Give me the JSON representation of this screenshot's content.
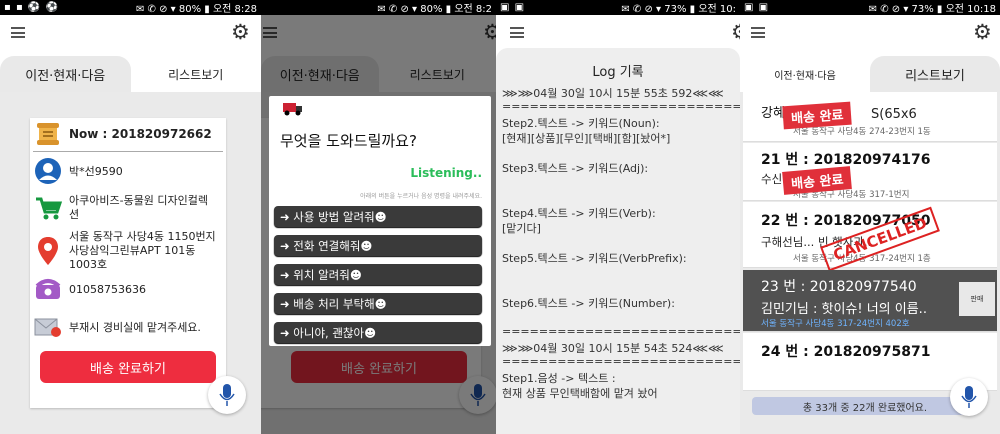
{
  "status_bars": [
    {
      "left": "▪ ▪ ⚽ ⚽",
      "right": "✉ ✆ ⊘ ▾ 80% ▮ 오전 8:28"
    },
    {
      "left": "",
      "right": "✉ ✆ ⊘ ▾ 80% ▮ 오전 8:2"
    },
    {
      "left": "▣ ▣",
      "right": "✉ ✆ ⊘ ▾ 73% ▮ 오전 10:"
    },
    {
      "left": "▣ ▣",
      "right": "✉ ✆ ⊘ ▾ 73% ▮ 오전 10:18"
    }
  ],
  "tabs": {
    "current": "이전·현재·다음",
    "list": "리스트보기"
  },
  "delivery": {
    "now": "Now : 201820972662",
    "name": "박*선9590",
    "shop": "아쿠아비즈-동물원 디자인컬렉션",
    "address": "서울 동작구  사당4동 1150번지 사당삼익그린뷰APT 101동 1003호",
    "phone": "01058753636",
    "memo": "부재시 경비실에 맡겨주세요.",
    "button": "배송 완료하기"
  },
  "assistant": {
    "question": "무엇을 도와드릴까요?",
    "listening": "Listening..",
    "hint": "아래의 버튼을 누르거나 음성 명령을 내려주세요.",
    "options": [
      "➜ 사용 방법 알려줘☻",
      "➜ 전화 연결해줘☻",
      "➜ 위치 알려줘☻",
      "➜ 배송 처리 부탁해☻",
      "➜ 아니야, 괜찮아☻"
    ]
  },
  "log": {
    "title": "Log 기록",
    "lines": [
      "⋙⋙04월 30일 10시 15분 55초 592⋘⋘",
      "================================",
      "Step2.텍스트 -> 키워드(Noun):",
      "[현재][상품][무인][택배][함][놨어*]",
      "",
      " Step3.텍스트 -> 키워드(Adj):",
      "",
      "",
      " Step4.텍스트 -> 키워드(Verb):",
      "[맡기다]",
      "",
      " Step5.텍스트 -> 키워드(VerbPrefix):",
      "",
      "",
      " Step6.텍스트 -> 키워드(Number):",
      "",
      "================================",
      "⋙⋙04월 30일 10시 15분 54초 524⋘⋘",
      "================================",
      "Step1.음성 -> 텍스트 :",
      "현재 상품 무인택배함에 맡겨 놨어"
    ]
  },
  "list": {
    "items": [
      {
        "title": "강혜경 ...",
        "sub": "",
        "addr": "서울 동작구 사당4동 274-23번지 1동",
        "stamp": "배송 완료",
        "label": "S(65x6"
      },
      {
        "title": "21 번 : 201820974176",
        "sub": "수신...: 백양...",
        "addr": "서울 동작구 사당4동 317-1번지",
        "stamp": "배송 완료"
      },
      {
        "title": "22 번 : 201820977050",
        "sub": "구해선님... 빈 햇사과..",
        "addr": "서울 동작구 사당4동 317-24번지 1층",
        "stamp": "CANCELLED"
      },
      {
        "title": "23 번 : 201820977540",
        "sub": "김민기님 : 핫이슈! 너의 이름..",
        "addr": "서울 동작구  사당4동 317-24번지 402호",
        "badge": "판매"
      },
      {
        "title": "24 번 : 201820975871",
        "sub": "",
        "addr": ""
      }
    ],
    "footer": "총 33개 중 22개 완료했어요."
  }
}
